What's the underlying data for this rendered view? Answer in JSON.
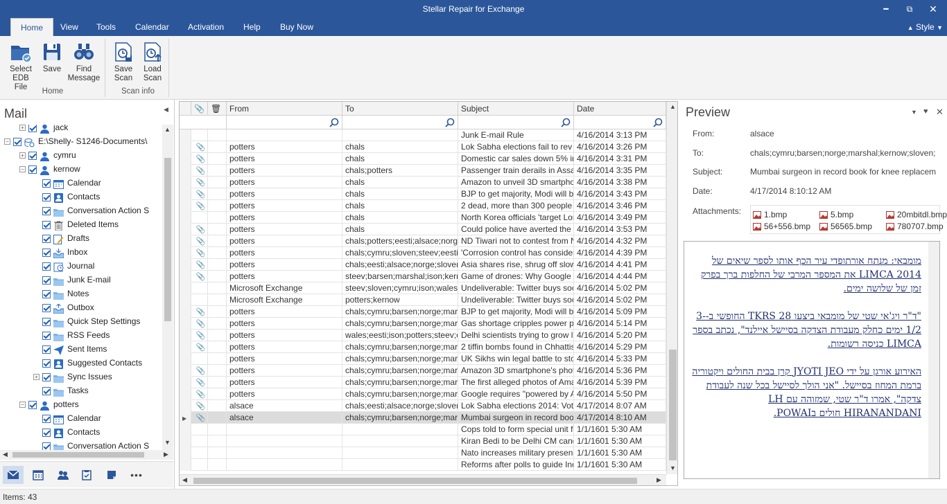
{
  "app": {
    "title": "Stellar Repair for Exchange"
  },
  "menu": {
    "tabs": [
      "Home",
      "View",
      "Tools",
      "Calendar",
      "Activation",
      "Help",
      "Buy Now"
    ],
    "active": "Home",
    "style": "Style"
  },
  "ribbon": {
    "home_group": {
      "label": "Home",
      "buttons": [
        {
          "line1": "Select",
          "line2": "EDB File",
          "icon": "select-edb-icon"
        },
        {
          "line1": "Save",
          "line2": "",
          "icon": "save-icon"
        },
        {
          "line1": "Find",
          "line2": "Message",
          "icon": "binoculars-icon"
        }
      ]
    },
    "scan_group": {
      "label": "Scan info",
      "buttons": [
        {
          "line1": "Save",
          "line2": "Scan",
          "icon": "save-scan-icon"
        },
        {
          "line1": "Load",
          "line2": "Scan",
          "icon": "load-scan-icon"
        }
      ]
    }
  },
  "mail_pane": {
    "title": "Mail",
    "tree": [
      {
        "label": "jack",
        "type": "user"
      },
      {
        "label": "E:\\Shelly- S1246-Documents\\",
        "type": "db"
      },
      {
        "label": "cymru",
        "type": "user"
      },
      {
        "label": "kernow",
        "type": "user"
      },
      {
        "label": "Calendar",
        "type": "calendar"
      },
      {
        "label": "Contacts",
        "type": "contacts"
      },
      {
        "label": "Conversation Action S",
        "type": "folder"
      },
      {
        "label": "Deleted Items",
        "type": "trash"
      },
      {
        "label": "Drafts",
        "type": "drafts"
      },
      {
        "label": "Inbox",
        "type": "inbox"
      },
      {
        "label": "Journal",
        "type": "journal"
      },
      {
        "label": "Junk E-mail",
        "type": "folder"
      },
      {
        "label": "Notes",
        "type": "folder"
      },
      {
        "label": "Outbox",
        "type": "outbox"
      },
      {
        "label": "Quick Step Settings",
        "type": "folder"
      },
      {
        "label": "RSS Feeds",
        "type": "folder"
      },
      {
        "label": "Sent Items",
        "type": "sent"
      },
      {
        "label": "Suggested Contacts",
        "type": "contacts"
      },
      {
        "label": "Sync Issues",
        "type": "folder"
      },
      {
        "label": "Tasks",
        "type": "folder"
      },
      {
        "label": "potters",
        "type": "user"
      },
      {
        "label": "Calendar",
        "type": "calendar"
      },
      {
        "label": "Contacts",
        "type": "contacts"
      },
      {
        "label": "Conversation Action S",
        "type": "folder"
      }
    ]
  },
  "grid": {
    "columns": [
      "",
      "",
      "From",
      "To",
      "Subject",
      "Date"
    ],
    "rows": [
      {
        "att": false,
        "from": "",
        "to": "",
        "subject": "Junk E-mail Rule",
        "date": "4/16/2014 3:13 PM"
      },
      {
        "att": true,
        "from": "potters",
        "to": "chals",
        "subject": "Lok Sabha elections fail to rev ...",
        "date": "4/16/2014 3:26 PM"
      },
      {
        "att": true,
        "from": "potters",
        "to": "chals",
        "subject": "Domestic car sales down 5% in ...",
        "date": "4/16/2014 3:31 PM"
      },
      {
        "att": true,
        "from": "potters",
        "to": "chals;potters",
        "subject": "Passenger train derails in Assam...",
        "date": "4/16/2014 3:35 PM"
      },
      {
        "att": true,
        "from": "potters",
        "to": "chals",
        "subject": "Amazon to unveil 3D smartphon...",
        "date": "4/16/2014 3:38 PM"
      },
      {
        "att": true,
        "from": "potters",
        "to": "chals",
        "subject": "BJP to get majority, Modi will be ...",
        "date": "4/16/2014 3:43 PM"
      },
      {
        "att": true,
        "from": "potters",
        "to": "chals",
        "subject": "2 dead, more than 300 people ...",
        "date": "4/16/2014 3:46 PM"
      },
      {
        "att": false,
        "from": "potters",
        "to": "chals",
        "subject": "North Korea officials 'target Lon...",
        "date": "4/16/2014 3:49 PM"
      },
      {
        "att": true,
        "from": "potters",
        "to": "chals",
        "subject": "Could police have averted the ...",
        "date": "4/16/2014 3:53 PM"
      },
      {
        "att": true,
        "from": "potters",
        "to": "chals;potters;eesti;alsace;norge...",
        "subject": "ND Tiwari not to contest from N...",
        "date": "4/16/2014 4:32 PM"
      },
      {
        "att": true,
        "from": "potters",
        "to": "chals;cymru;sloven;steev;eesti",
        "subject": "'Corrosion control has considera...",
        "date": "4/16/2014 4:39 PM"
      },
      {
        "att": true,
        "from": "potters",
        "to": "chals;eesti;alsace;norge;sloven;...",
        "subject": "Asia shares rise, shrug off slowe...",
        "date": "4/16/2014 4:41 PM"
      },
      {
        "att": true,
        "from": "potters",
        "to": "steev;barsen;marshal;ison;kern...",
        "subject": "Game of drones: Why Google a...",
        "date": "4/16/2014 4:44 PM"
      },
      {
        "att": false,
        "from": "Microsoft Exchange",
        "to": "steev;sloven;cymru;ison;wales;...",
        "subject": "Undeliverable: Twitter buys soci...",
        "date": "4/16/2014 5:02 PM"
      },
      {
        "att": false,
        "from": "Microsoft Exchange",
        "to": "potters;kernow",
        "subject": "Undeliverable: Twitter buys soci...",
        "date": "4/16/2014 5:02 PM"
      },
      {
        "att": true,
        "from": "potters",
        "to": "chals;cymru;barsen;norge;marshal",
        "subject": "BJP to get majority, Modi will be ...",
        "date": "4/16/2014 5:09 PM"
      },
      {
        "att": true,
        "from": "potters",
        "to": "chals;cymru;barsen;norge;mars...",
        "subject": "Gas shortage cripples power pla...",
        "date": "4/16/2014 5:14 PM"
      },
      {
        "att": true,
        "from": "potters",
        "to": "wales;eesti;ison;potters;steev;c...",
        "subject": "Delhi scientists trying to grow liv...",
        "date": "4/16/2014 5:20 PM"
      },
      {
        "att": true,
        "from": "potters",
        "to": "chals;cymru;barsen;norge;mars...",
        "subject": "2 tiffin bombs found in Chhattisg...",
        "date": "4/16/2014 5:29 PM"
      },
      {
        "att": false,
        "from": "potters",
        "to": "chals;cymru;barsen;norge;mars...",
        "subject": "UK Sikhs win legal battle to sto...",
        "date": "4/16/2014 5:33 PM"
      },
      {
        "att": true,
        "from": "potters",
        "to": "chals;cymru;barsen;norge;mars...",
        "subject": "Amazon 3D smartphone's photo...",
        "date": "4/16/2014 5:36 PM"
      },
      {
        "att": true,
        "from": "potters",
        "to": "chals;cymru;barsen;norge;marshal",
        "subject": "The first alleged photos of Amaz...",
        "date": "4/16/2014 5:39 PM"
      },
      {
        "att": true,
        "from": "potters",
        "to": "chals;cymru;barsen;norge;mars...",
        "subject": "Google requires \"powered by An...",
        "date": "4/16/2014 5:50 PM"
      },
      {
        "att": true,
        "from": "alsace",
        "to": "chals;eesti;alsace;norge;sloven;...",
        "subject": "Lok Sabha elections 2014: Voti...",
        "date": "4/17/2014 8:07 AM"
      },
      {
        "att": true,
        "from": "alsace",
        "to": "chals;cymru;barsen;norge;mars...",
        "subject": "Mumbai surgeon in record book...",
        "date": "4/17/2014 8:10 AM",
        "selected": true
      },
      {
        "att": false,
        "from": "",
        "to": "",
        "subject": "Cops told to form special unit for...",
        "date": "1/1/1601 5:30 AM"
      },
      {
        "att": false,
        "from": "",
        "to": "",
        "subject": "Kiran Bedi to be Delhi CM candi...",
        "date": "1/1/1601 5:30 AM"
      },
      {
        "att": false,
        "from": "",
        "to": "",
        "subject": "Nato increases military presenc...",
        "date": "1/1/1601 5:30 AM"
      },
      {
        "att": false,
        "from": "",
        "to": "",
        "subject": "Reforms after polls to guide Indi...",
        "date": "1/1/1601 5:30 AM"
      }
    ]
  },
  "preview": {
    "title": "Preview",
    "from_label": "From:",
    "from": "alsace",
    "to_label": "To:",
    "to": "chals;cymru;barsen;norge;marshal;kernow;sloven;steev;alsace",
    "subject_label": "Subject:",
    "subject": "Mumbai surgeon in record book for knee replacements",
    "date_label": "Date:",
    "date": "4/17/2014 8:10:12 AM",
    "attachments_label": "Attachments:",
    "attachments": [
      "1.bmp",
      "5.bmp",
      "20mbitdl.bmp",
      "56+556.bmp",
      "56565.bmp",
      "780707.bmp"
    ],
    "body": [
      "מומבאי: מנתח אורתופדי עיר הכף אותו לספר שיאים של LIMCA 2014 את המספר המרבי של החלפות ברך בפרק זמן של שלושה ימים.",
      "\"ד\"ר ויג'אי שטי של מומבאי ביצעו 28 TKRS החופשי ב-3-1/2 ימים כחלק מעבודת הצדקה בסיישל איילנד\", נכתב בספר LIMCA כניסה רשומות.",
      "האירוע אורגן על ידי JYOTI JEO קרן בבית החולים ויקטוריה ברמת המחוז בסיישל. \"אני הולך לסיישל בכל שנה לעבודת צדקה\", אמרו ד\"ר שטי, שמזוהה עם LH HIRANANDANI חולים בPOWAI."
    ]
  },
  "status": {
    "items": "Items: 43"
  }
}
